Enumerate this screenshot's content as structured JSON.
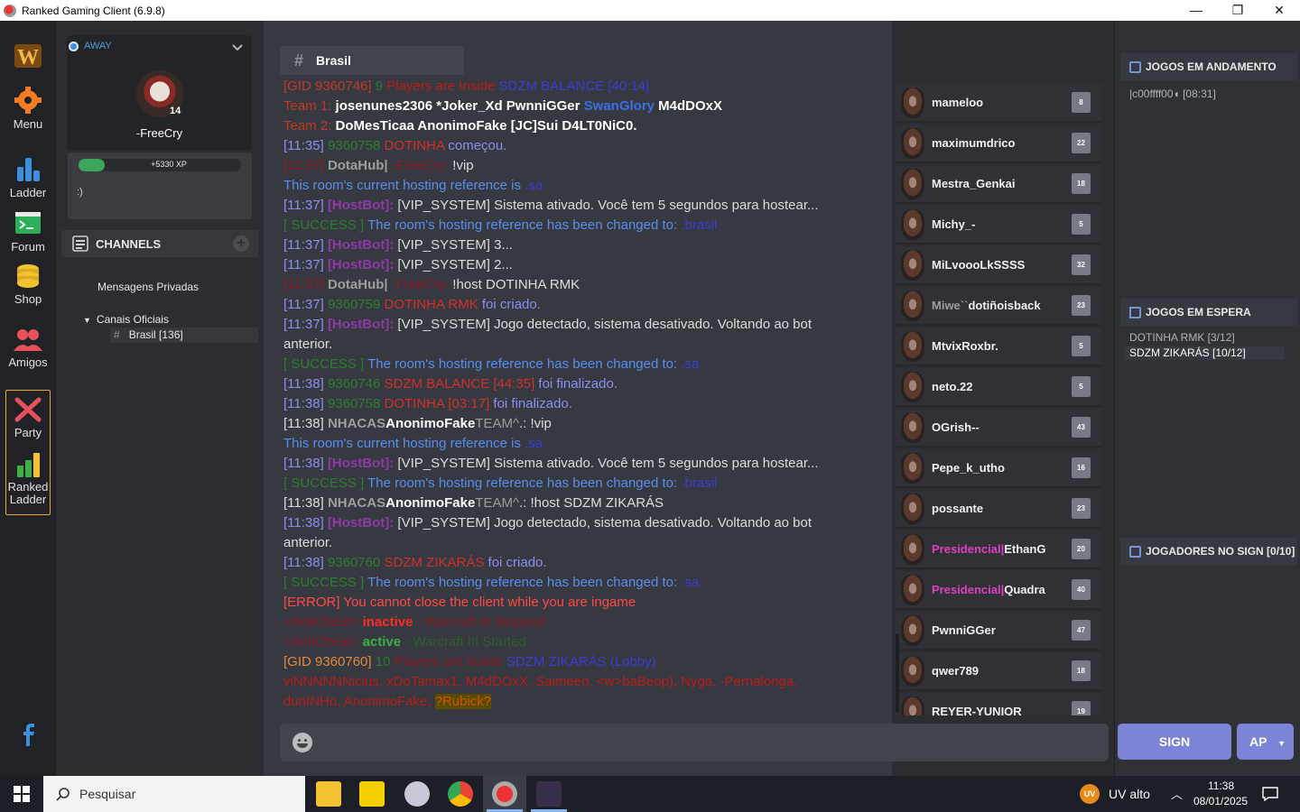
{
  "window": {
    "title": "Ranked Gaming Client (6.9.8)",
    "min": "—",
    "restore": "❐",
    "close": "✕"
  },
  "rail": {
    "menu": "Menu",
    "ladder": "Ladder",
    "forum": "Forum",
    "shop": "Shop",
    "amigos": "Amigos",
    "party": "Party",
    "ranked_ladder_1": "Ranked",
    "ranked_ladder_2": "Ladder"
  },
  "profile": {
    "status": "AWAY",
    "level": "14",
    "username": "-FreeCry",
    "xp_label": "+5330 XP",
    "xp_fraction": 0.16,
    "motto": ":)"
  },
  "channels": {
    "header": "CHANNELS",
    "private_messages": "Mensagens Privadas",
    "group": "Canais Oficiais",
    "active_channel": "Brasil [136]"
  },
  "chat": {
    "channel_name": "Brasil",
    "lines": [
      [
        [
          "[GID 9360746] ",
          "#c0392b"
        ],
        [
          "9 ",
          "#2e7d32"
        ],
        [
          "Players are Inside ",
          "#b71c1c"
        ],
        [
          "SDZM BALANCE [40:14]",
          "#3b3bd6"
        ]
      ],
      [
        [
          "Team 1:  ",
          "#c0392b"
        ],
        [
          "josenunes2306   *Joker_Xd   PwnniGGer   ",
          "#ffffff",
          "b"
        ],
        [
          "SwanGlory",
          "#3b6ee8",
          "b"
        ],
        [
          "   M4dDOxX",
          "#ffffff",
          "b"
        ]
      ],
      [
        [
          "Team 2:  ",
          "#c0392b"
        ],
        [
          "DoMesTicaa   AnonimoFake   [JC]Sui   D4LT0NiC0.",
          "#ffffff",
          "b"
        ]
      ],
      [
        [
          "[11:35] ",
          "#8a8ff0"
        ],
        [
          "9360758 ",
          "#2e7d32"
        ],
        [
          "DOTINHA ",
          "#d32f2f"
        ],
        [
          "começou.",
          "#8a8ff0"
        ]
      ],
      [
        [
          "[11:37] ",
          "#8b1a2b"
        ],
        [
          "DotaHub| ",
          "#9e9e9e",
          "b"
        ],
        [
          "-FreeCry:",
          "#8b1a2b"
        ],
        [
          " !vip",
          "#dcddde"
        ]
      ],
      [
        [
          "This room's current hosting reference is ",
          "#5b8def"
        ],
        [
          ".sa",
          "#3b3bd6"
        ]
      ],
      [
        [
          "[11:37] ",
          "#8a8ff0"
        ],
        [
          "[HostBot]:",
          "#8e3aa8",
          "b"
        ],
        [
          " [VIP_SYSTEM] Sistema ativado. Você tem 5 segundos para hostear...",
          "#dcddde"
        ]
      ],
      [
        [
          "[ SUCCESS ] ",
          "#2e7d32"
        ],
        [
          "The room's hosting reference has been changed to: ",
          "#5b8def"
        ],
        [
          ".brasil",
          "#3b3bd6"
        ]
      ],
      [
        [
          "[11:37] ",
          "#8a8ff0"
        ],
        [
          "[HostBot]:",
          "#8e3aa8",
          "b"
        ],
        [
          " [VIP_SYSTEM] 3...",
          "#dcddde"
        ]
      ],
      [
        [
          "[11:37] ",
          "#8a8ff0"
        ],
        [
          "[HostBot]:",
          "#8e3aa8",
          "b"
        ],
        [
          " [VIP_SYSTEM] 2...",
          "#dcddde"
        ]
      ],
      [
        [
          "[11:37] ",
          "#8b1a2b"
        ],
        [
          "DotaHub| ",
          "#9e9e9e",
          "b"
        ],
        [
          "-FreeCry:",
          "#8b1a2b"
        ],
        [
          " !host DOTINHA RMK",
          "#dcddde"
        ]
      ],
      [
        [
          "[11:37] ",
          "#8a8ff0"
        ],
        [
          "9360759 ",
          "#2e7d32"
        ],
        [
          "DOTINHA RMK ",
          "#d32f2f"
        ],
        [
          "foi criado.",
          "#8a8ff0"
        ]
      ],
      [
        [
          "[11:37] ",
          "#8a8ff0"
        ],
        [
          "[HostBot]:",
          "#8e3aa8",
          "b"
        ],
        [
          " [VIP_SYSTEM] Jogo detectado, sistema desativado. Voltando ao bot anterior.",
          "#dcddde"
        ]
      ],
      [
        [
          "[ SUCCESS ] ",
          "#2e7d32"
        ],
        [
          "The room's hosting reference has been changed to: ",
          "#5b8def"
        ],
        [
          ".sa",
          "#3b3bd6"
        ]
      ],
      [
        [
          "[11:38] ",
          "#8a8ff0"
        ],
        [
          "9360746 ",
          "#2e7d32"
        ],
        [
          "SDZM BALANCE [44:35] ",
          "#d32f2f"
        ],
        [
          "foi finalizado.",
          "#8a8ff0"
        ]
      ],
      [
        [
          "[11:38] ",
          "#8a8ff0"
        ],
        [
          "9360758 ",
          "#2e7d32"
        ],
        [
          "DOTINHA [03:17] ",
          "#d32f2f"
        ],
        [
          "foi finalizado.",
          "#8a8ff0"
        ]
      ],
      [
        [
          "[11:38] ",
          "#dcddde"
        ],
        [
          "NHACAS",
          "#9e9e9e",
          "b"
        ],
        [
          "AnonimoFake",
          "#ffffff",
          "b"
        ],
        [
          "TEAM^",
          "#9e9e9e"
        ],
        [
          ".: !vip",
          "#dcddde"
        ]
      ],
      [
        [
          "This room's current hosting reference is ",
          "#5b8def"
        ],
        [
          ".sa",
          "#3b3bd6"
        ]
      ],
      [
        [
          "[11:38] ",
          "#8a8ff0"
        ],
        [
          "[HostBot]:",
          "#8e3aa8",
          "b"
        ],
        [
          " [VIP_SYSTEM] Sistema ativado. Você tem 5 segundos para hostear...",
          "#dcddde"
        ]
      ],
      [
        [
          "[ SUCCESS ] ",
          "#2e7d32"
        ],
        [
          "The room's hosting reference has been changed to: ",
          "#5b8def"
        ],
        [
          ".brasil",
          "#3b3bd6"
        ]
      ],
      [
        [
          "[11:38] ",
          "#dcddde"
        ],
        [
          "NHACAS",
          "#9e9e9e",
          "b"
        ],
        [
          "AnonimoFake",
          "#ffffff",
          "b"
        ],
        [
          "TEAM^",
          "#9e9e9e"
        ],
        [
          ".: !host SDZM ZIKARÁS",
          "#dcddde"
        ]
      ],
      [
        [
          "[11:38] ",
          "#8a8ff0"
        ],
        [
          "[HostBot]:",
          "#8e3aa8",
          "b"
        ],
        [
          " [VIP_SYSTEM] Jogo detectado, sistema desativado. Voltando ao bot anterior.",
          "#dcddde"
        ]
      ],
      [
        [
          "[11:38] ",
          "#8a8ff0"
        ],
        [
          "9360760 ",
          "#2e7d32"
        ],
        [
          "SDZM ZIKARÁS ",
          "#d32f2f"
        ],
        [
          "foi criado.",
          "#8a8ff0"
        ]
      ],
      [
        [
          "[ SUCCESS ] ",
          "#2e7d32"
        ],
        [
          "The room's hosting reference has been changed to: ",
          "#5b8def"
        ],
        [
          ".sa",
          "#3b3bd6"
        ]
      ],
      [
        [
          "[ERROR] You cannot close the client while you are ingame",
          "#ff4a4a"
        ]
      ],
      [
        [
          "<AntiCheat> ",
          "#8b1a2b"
        ],
        [
          "inactive",
          "#ff2a2a",
          "b"
        ],
        [
          " - Warcraft III Stopped",
          "#8b1a2b"
        ]
      ],
      [
        [
          "<AntiCheat> ",
          "#8b1a2b"
        ],
        [
          "active",
          "#3cb043",
          "b"
        ],
        [
          " - Warcraft III Started",
          "#2e5e2e"
        ]
      ],
      [
        [
          "[GID 9360760] ",
          "#e08a3a"
        ],
        [
          "10 ",
          "#2e7d32"
        ],
        [
          "Players are Inside ",
          "#8b1a2b"
        ],
        [
          "SDZM ZIKARÁS (Lobby)",
          "#3b3bd6"
        ]
      ],
      [
        [
          "viNNNNNNicius, xDoTamax1, M4dDOxX, Saimeen, <w>baBeop), Nyga, -Pernalonga, dunINHo, AnonimoFake, ",
          "#b71c1c"
        ],
        [
          "?Rubick?",
          "#d35400",
          "hl"
        ]
      ]
    ]
  },
  "members": [
    {
      "name": "mameloo",
      "badge": "8"
    },
    {
      "name": "maximumdrico",
      "badge": "22"
    },
    {
      "name": "Mestra_Genkai",
      "badge": "18"
    },
    {
      "name": "Michy_-",
      "badge": "5"
    },
    {
      "name": "MiLvoooLkSSSS",
      "badge": "32"
    },
    {
      "name": "Miwe``dotiñoisback",
      "badge": "23",
      "prefix": "Miwe``",
      "rest": "dotiñoisback"
    },
    {
      "name": "MtvixRoxbr.",
      "badge": "5"
    },
    {
      "name": "neto.22",
      "badge": "5"
    },
    {
      "name": "OGrish--",
      "badge": "43"
    },
    {
      "name": "Pepe_k_utho",
      "badge": "16"
    },
    {
      "name": "possante",
      "badge": "23"
    },
    {
      "name": "Presidencial|EthanG",
      "badge": "20",
      "tag": "Presidencial|",
      "rest": "EthanG"
    },
    {
      "name": "Presidencial|Quadra",
      "badge": "40",
      "tag": "Presidencial|",
      "rest": "Quadra"
    },
    {
      "name": "PwnniGGer",
      "badge": "47"
    },
    {
      "name": "qwer789",
      "badge": "18"
    },
    {
      "name": "REYER-YUNIOR",
      "badge": "19"
    }
  ],
  "right": {
    "games_in_progress": "JOGOS EM ANDAMENTO",
    "in_progress_item": "|c00ffff00◖ [08:31]",
    "games_waiting": "JOGOS EM ESPERA",
    "waiting_1": "DOTINHA RMK [3/12]",
    "waiting_2": "SDZM ZIKARÁS [10/12]",
    "sign_players": "JOGADORES NO SIGN [0/10]",
    "sign_button": "SIGN",
    "ap_button": "AP"
  },
  "taskbar": {
    "search": "Pesquisar",
    "weather": "UV alto",
    "time": "11:38",
    "date": "08/01/2025"
  },
  "colors": {
    "accent": "#7b84d6",
    "rail_bg": "#202225",
    "chat_bg": "#36393f",
    "xp_green": "#3ba55d",
    "party_border": "#e8a33a"
  }
}
